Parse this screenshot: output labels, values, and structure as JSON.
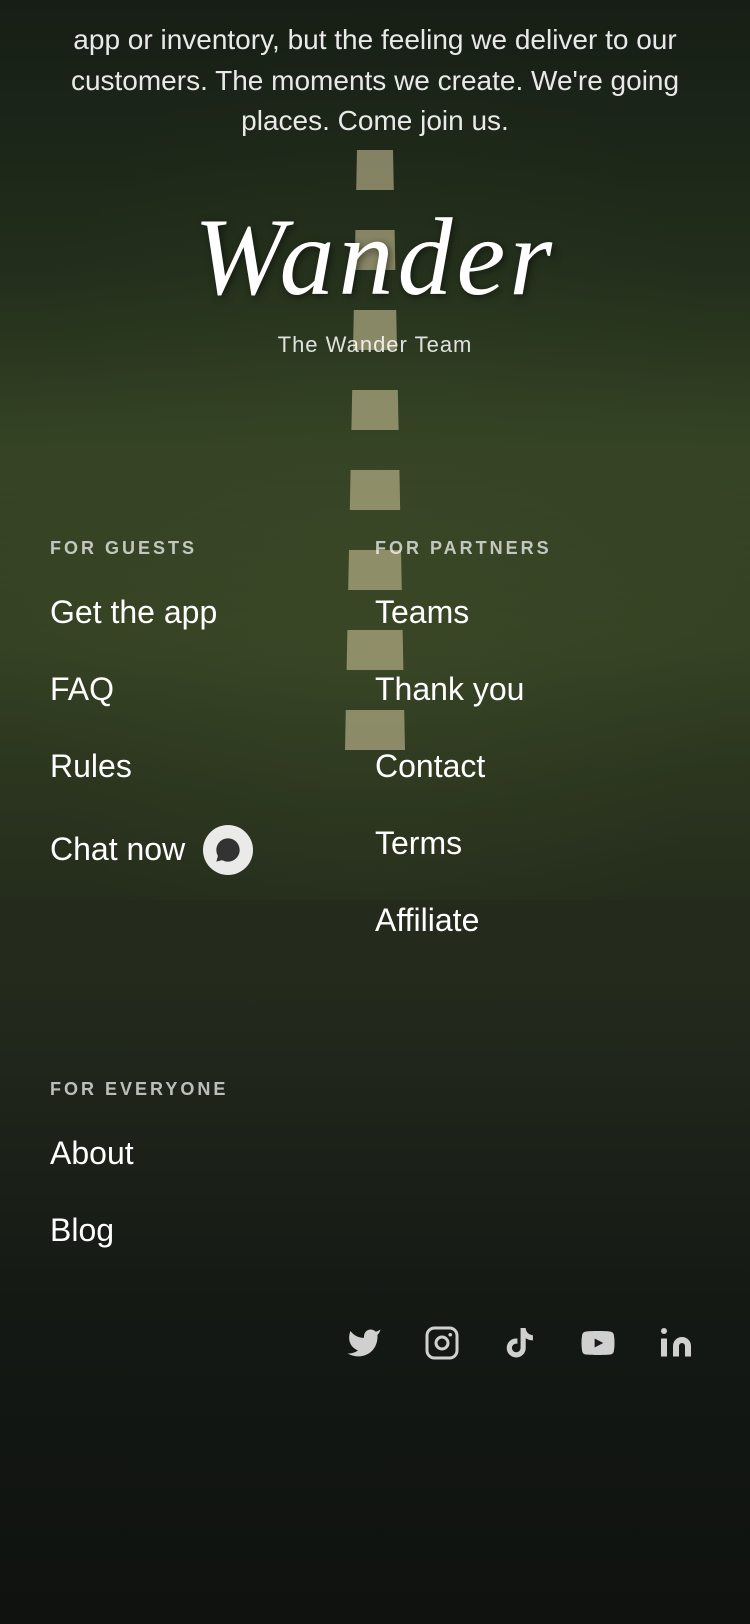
{
  "background": {
    "top_text": "app or inventory, but the feeling we deliver to our customers. The moments we create. We're going places. Come join us."
  },
  "logo": {
    "text": "Wander",
    "subtitle": "The Wander Team"
  },
  "guests": {
    "section_title": "FOR GUESTS",
    "links": [
      {
        "label": "Get the app",
        "id": "get-the-app"
      },
      {
        "label": "FAQ",
        "id": "faq"
      },
      {
        "label": "Rules",
        "id": "rules"
      },
      {
        "label": "Chat now",
        "id": "chat-now"
      }
    ]
  },
  "partners": {
    "section_title": "FOR PARTNERS",
    "links": [
      {
        "label": "Teams",
        "id": "teams"
      },
      {
        "label": "Thank you",
        "id": "thank-you"
      },
      {
        "label": "Contact",
        "id": "contact"
      },
      {
        "label": "Terms",
        "id": "terms"
      },
      {
        "label": "Affiliate",
        "id": "affiliate"
      }
    ]
  },
  "everyone": {
    "section_title": "FOR EVERYONE",
    "links": [
      {
        "label": "About",
        "id": "about"
      },
      {
        "label": "Blog",
        "id": "blog"
      }
    ]
  },
  "social": {
    "icons": [
      "twitter",
      "instagram",
      "tiktok",
      "youtube",
      "linkedin"
    ]
  }
}
